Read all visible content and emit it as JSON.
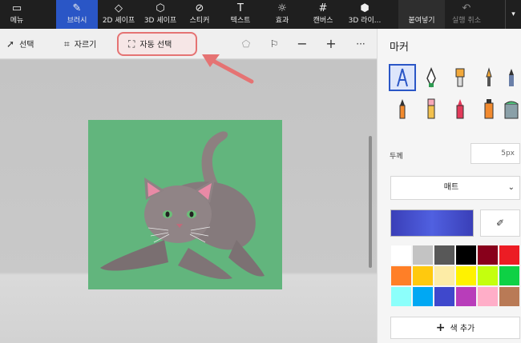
{
  "ribbon": {
    "items": [
      {
        "label": "메뉴",
        "icon": "folder-icon"
      },
      {
        "label": "브러시",
        "icon": "brush-icon"
      },
      {
        "label": "2D 셰이프",
        "icon": "2d-shapes-icon"
      },
      {
        "label": "3D 셰이프",
        "icon": "3d-shapes-icon"
      },
      {
        "label": "스티커",
        "icon": "sticker-icon"
      },
      {
        "label": "텍스트",
        "icon": "text-icon"
      },
      {
        "label": "효과",
        "icon": "effects-icon"
      },
      {
        "label": "캔버스",
        "icon": "canvas-icon"
      },
      {
        "label": "3D 라이...",
        "icon": "3d-library-icon"
      },
      {
        "label": "붙여넣기",
        "icon": "paste-icon"
      },
      {
        "label": "실행 취소",
        "icon": "undo-icon"
      }
    ]
  },
  "toolbar": {
    "select_label": "선택",
    "crop_label": "자르기",
    "magic_select_label": "자동 선택"
  },
  "panel": {
    "title": "마커",
    "thickness_label": "두께",
    "thickness_value": "5px",
    "finish_label": "매트",
    "add_color_label": "색 추가"
  },
  "colors": {
    "accent": "#2a56c6",
    "current_color": "#3f46c4",
    "highlight": "#e57373",
    "image_bg": "#62b57d",
    "palette": [
      "#ffffff",
      "#c3c3c3",
      "#585858",
      "#000000",
      "#88001b",
      "#ec1c24",
      "#ff7f27",
      "#ffc90e",
      "#fdeca6",
      "#fff200",
      "#c4ff0e",
      "#0ed145",
      "#8cfffb",
      "#00a8f3",
      "#3f48cc",
      "#b83dba",
      "#ffaec8",
      "#b97a56"
    ]
  }
}
